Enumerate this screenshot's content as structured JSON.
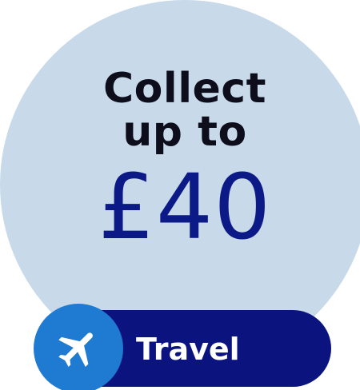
{
  "promo": {
    "headline_line1": "Collect",
    "headline_line2": "up to",
    "amount": "£40"
  },
  "category_pill": {
    "label": "Travel",
    "icon": "airplane-icon"
  },
  "colors": {
    "circle_background": "#c8dae9",
    "headline_text": "#0d0d1c",
    "amount_text": "#0c1a88",
    "pill_background": "#0b137e",
    "icon_circle": "#1f7ad1",
    "pill_text": "#ffffff"
  }
}
